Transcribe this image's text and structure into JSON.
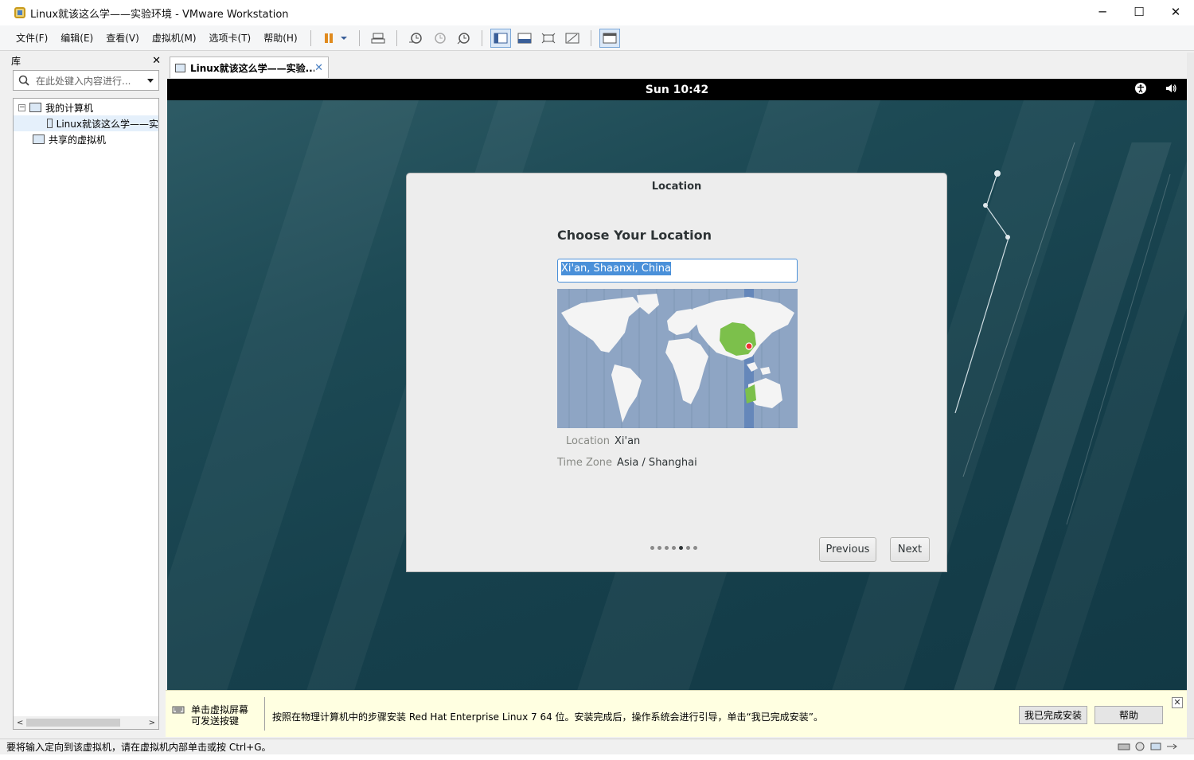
{
  "window": {
    "title": "Linux就该这么学——实验环境 - VMware Workstation",
    "controls": [
      "─",
      "☐",
      "✕"
    ]
  },
  "menu": [
    "文件(F)",
    "编辑(E)",
    "查看(V)",
    "虚拟机(M)",
    "选项卡(T)",
    "帮助(H)"
  ],
  "toolbar": {
    "icons": [
      "pause-icon",
      "send-keys-icon",
      "snapshot-icon",
      "revert-snapshot-icon",
      "snapshot-manager-icon",
      "console-view-icon",
      "quick-switch-icon",
      "fullscreen-icon",
      "unity-icon",
      "library-toggle-icon"
    ]
  },
  "library": {
    "title": "库",
    "close": "✕",
    "search_placeholder": "在此处键入内容进行...",
    "tree": {
      "my_computer": "我的计算机",
      "vm": "Linux就该这么学——实",
      "shared": "共享的虚拟机",
      "toggle": "−"
    }
  },
  "tab": {
    "label": "Linux就该这么学——实验...",
    "close": "✕"
  },
  "vm": {
    "clock": "Sun 10:42",
    "dialog": {
      "title": "Location",
      "heading": "Choose Your Location",
      "input_value": "Xi'an, Shaanxi, China",
      "location_key": "Location",
      "location_value": "Xi'an",
      "timezone_key": "Time Zone",
      "timezone_value": "Asia / Shanghai",
      "page_count": 7,
      "current_page": 5,
      "previous": "Previous",
      "next": "Next"
    }
  },
  "hint": {
    "left_line1": "单击虚拟屏幕",
    "left_line2": "可发送按键",
    "message": "按照在物理计算机中的步骤安装 Red Hat Enterprise Linux 7 64 位。安装完成后，操作系统会进行引导，单击“我已完成安装”。",
    "done_button": "我已完成安装",
    "help_button": "帮助",
    "close": "✕"
  },
  "status": {
    "text": "要将输入定向到该虚拟机，请在虚拟机内部单击或按 Ctrl+G。"
  },
  "colors": {
    "accent": "#4a90d9",
    "hint_bg": "#ffffe1",
    "desktop": "#1d4a55",
    "land": "#f2f2f2",
    "selected_region": "#7cc04b"
  }
}
